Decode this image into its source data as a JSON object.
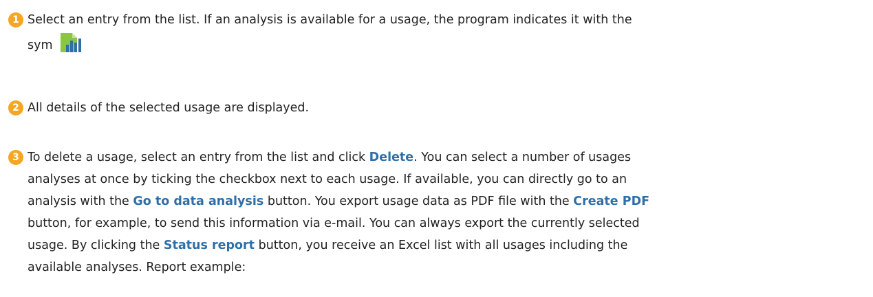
{
  "colors": {
    "marker": "#f5a623",
    "keyword": "#2f6fa8",
    "text": "#222222",
    "icon_green": "#8cc63f",
    "icon_blue": "#2f6fa8"
  },
  "items": [
    {
      "number": "1",
      "lines": [
        "Select an entry from the list. If an analysis is available for a usage, the program indicates it with the",
        "sym"
      ],
      "icon": "analysis-chart-icon"
    },
    {
      "number": "2",
      "lines": [
        "All details of the selected usage are displayed."
      ]
    },
    {
      "number": "3",
      "segments": {
        "l1a": "To delete a usage, select an entry from the list and click ",
        "l1b": "Delete",
        "l1c": ". You can select a number of usages",
        "l2": "analyses at once by ticking the checkbox next to each usage. If available, you can directly go to an",
        "l3a": "analysis with the ",
        "l3b": "Go to data analysis",
        "l3c": " button. You export usage data as PDF file with the ",
        "l3d": "Create PDF",
        "l4": "button, for example, to send this information via e-mail. You can always export the currently selected",
        "l5a": "usage. By clicking the ",
        "l5b": "Status report",
        "l5c": " button, you receive an Excel list with all usages including the",
        "l6": "available analyses. Report example:"
      }
    }
  ]
}
